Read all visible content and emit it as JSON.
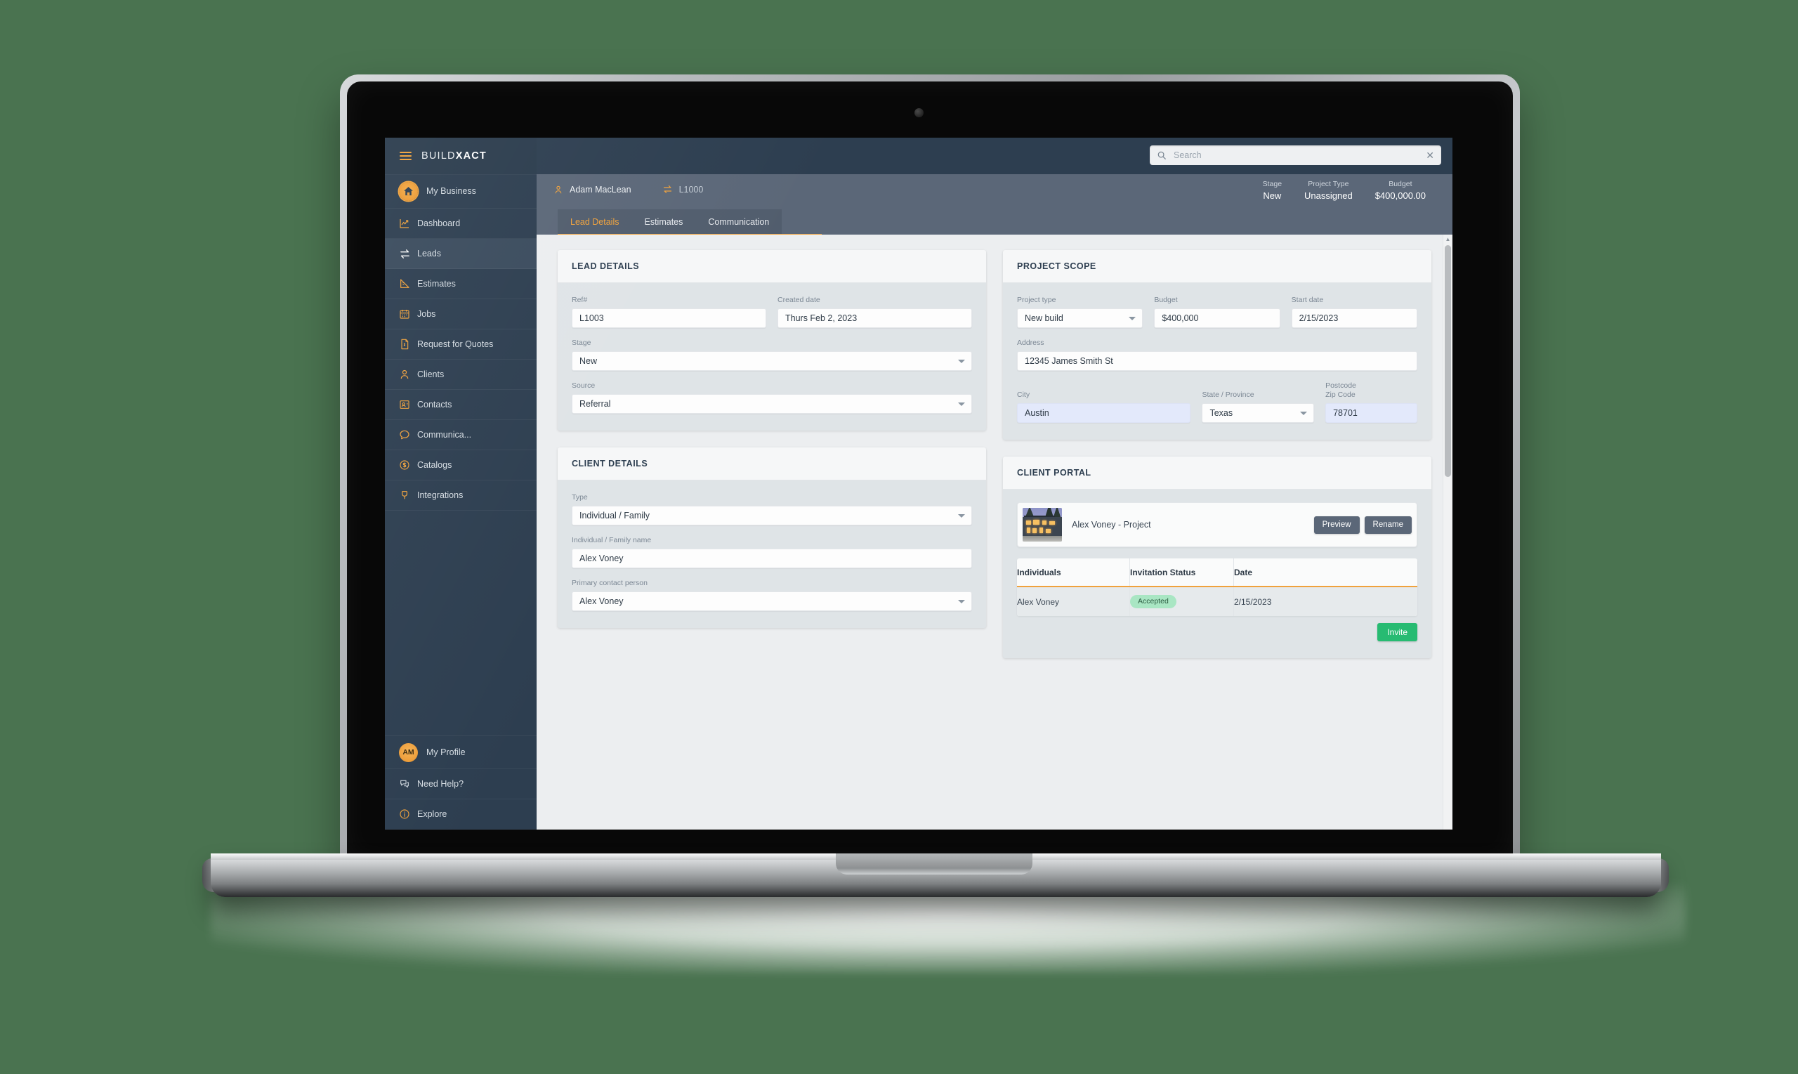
{
  "brand": {
    "name_light": "BUILD",
    "name_bold": "XACT"
  },
  "search": {
    "placeholder": "Search",
    "value": "",
    "icon": "search-icon",
    "clear_icon": "close-icon"
  },
  "sidebar": {
    "items": [
      {
        "label": "My Business",
        "icon": "home-logo-icon",
        "active": false
      },
      {
        "label": "Dashboard",
        "icon": "chart-line-icon",
        "active": false
      },
      {
        "label": "Leads",
        "icon": "swap-arrows-icon",
        "active": true
      },
      {
        "label": "Estimates",
        "icon": "ruler-triangle-icon",
        "active": false
      },
      {
        "label": "Jobs",
        "icon": "calendar-icon",
        "active": false
      },
      {
        "label": "Request for Quotes",
        "icon": "document-dollar-icon",
        "active": false
      },
      {
        "label": "Clients",
        "icon": "person-icon",
        "active": false
      },
      {
        "label": "Contacts",
        "icon": "contact-card-icon",
        "active": false
      },
      {
        "label": "Communica...",
        "icon": "speech-bubble-icon",
        "active": false
      },
      {
        "label": "Catalogs",
        "icon": "dollar-circle-icon",
        "active": false
      },
      {
        "label": "Integrations",
        "icon": "plug-icon",
        "active": false
      }
    ],
    "bottom": [
      {
        "label": "My Profile",
        "icon": "avatar",
        "initials": "AM"
      },
      {
        "label": "Need Help?",
        "icon": "chat-bubbles-icon"
      },
      {
        "label": "Explore",
        "icon": "info-circle-icon"
      }
    ]
  },
  "header": {
    "user": "Adam MacLean",
    "user_icon": "person-icon",
    "lead_ref": "L1000",
    "lead_icon": "swap-arrows-icon",
    "stats": [
      {
        "key": "Stage",
        "value": "New"
      },
      {
        "key": "Project Type",
        "value": "Unassigned"
      },
      {
        "key": "Budget",
        "value": "$400,000.00"
      }
    ]
  },
  "tabs": [
    {
      "label": "Lead Details",
      "active": true
    },
    {
      "label": "Estimates",
      "active": false
    },
    {
      "label": "Communication",
      "active": false
    }
  ],
  "lead_details": {
    "title": "LEAD DETAILS",
    "ref_label": "Ref#",
    "ref_value": "L1003",
    "created_label": "Created date",
    "created_value": "Thurs Feb 2, 2023",
    "stage_label": "Stage",
    "stage_value": "New",
    "source_label": "Source",
    "source_value": "Referral"
  },
  "project_scope": {
    "title": "PROJECT SCOPE",
    "project_type_label": "Project type",
    "project_type_value": "New build",
    "budget_label": "Budget",
    "budget_value": "$400,000",
    "start_date_label": "Start date",
    "start_date_value": "2/15/2023",
    "address_label": "Address",
    "address_value": "12345 James Smith St",
    "city_label": "City",
    "city_value": "Austin",
    "state_label": "State / Province",
    "state_value": "Texas",
    "postcode_label_line1": "Postcode",
    "postcode_label_line2": "Zip Code",
    "postcode_value": "78701"
  },
  "client_details": {
    "title": "CLIENT DETAILS",
    "type_label": "Type",
    "type_value": "Individual / Family",
    "name_label": "Individual / Family name",
    "name_value": "Alex Voney",
    "contact_label": "Primary contact person",
    "contact_value": "Alex Voney"
  },
  "client_portal": {
    "title": "CLIENT PORTAL",
    "project_name": "Alex Voney - Project",
    "thumbnail_alt": "house-at-dusk-photo",
    "preview_label": "Preview",
    "rename_label": "Rename",
    "columns": [
      "Individuals",
      "Invitation Status",
      "Date"
    ],
    "rows": [
      {
        "individual": "Alex Voney",
        "status": "Accepted",
        "date": "2/15/2023"
      }
    ],
    "invite_label": "Invite"
  },
  "colors": {
    "accent": "#f0a23c",
    "sidebar": "#2d3e50",
    "subheader": "#5b6778",
    "success": "#27bb72",
    "pill": "#a9e6c3",
    "page_bg": "#4a7350"
  }
}
